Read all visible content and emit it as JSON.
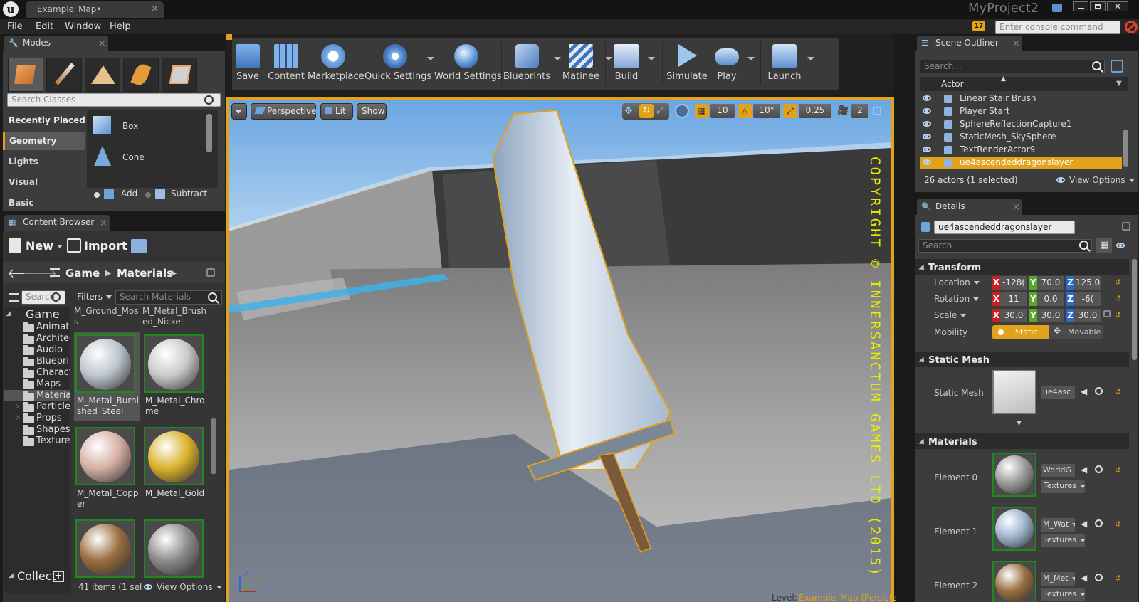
{
  "window": {
    "doc_tab": "Example_Map•",
    "project": "MyProject2"
  },
  "menu": [
    "File",
    "Edit",
    "Window",
    "Help"
  ],
  "console": {
    "placeholder": "Enter console command",
    "badge": "17"
  },
  "modes": {
    "tab": "Modes",
    "search_placeholder": "Search Classes",
    "categories": [
      "Recently Placed",
      "Geometry",
      "Lights",
      "Visual",
      "Basic"
    ],
    "items": [
      "Box",
      "Cone"
    ],
    "add": "Add",
    "subtract": "Subtract"
  },
  "content_browser": {
    "tab": "Content Browser",
    "new": "New",
    "import": "Import",
    "path": [
      "Game",
      "Materials"
    ],
    "search_small": "Search",
    "filters": "Filters",
    "search_materials": "Search Materials",
    "tree": {
      "root": "Game",
      "folders": [
        "Animati",
        "Architec",
        "Audio",
        "Blueprir",
        "Charact",
        "Maps",
        "Materia",
        "Particle",
        "Props",
        "Shapes",
        "Texture"
      ]
    },
    "assets_top": [
      "M_Ground_Moss",
      "M_Metal_Brushed_Nickel"
    ],
    "assets": [
      {
        "name": "M_Metal_Burnished_Steel",
        "color": "#bcc4cc"
      },
      {
        "name": "M_Metal_Chrome",
        "color": "#c8cac9"
      },
      {
        "name": "M_Metal_Copper",
        "color": "#d6b0a6"
      },
      {
        "name": "M_Metal_Gold",
        "color": "#d9b22c"
      },
      {
        "name": "",
        "color": "#9a6e3f"
      },
      {
        "name": "",
        "color": "#8c8c8c"
      }
    ],
    "collections": "Collect",
    "status": "41 items (1 sel",
    "view_options": "View Options"
  },
  "toolbar": [
    {
      "label": "Save",
      "icon": "save-icon",
      "dd": false
    },
    {
      "label": "Content",
      "icon": "content-icon",
      "dd": false
    },
    {
      "label": "Marketplace",
      "icon": "marketplace-icon",
      "dd": false
    },
    {
      "label": "Quick Settings",
      "icon": "quick-settings-icon",
      "dd": true
    },
    {
      "label": "World Settings",
      "icon": "world-settings-icon",
      "dd": false
    },
    {
      "label": "Blueprints",
      "icon": "blueprints-icon",
      "dd": true
    },
    {
      "label": "Matinee",
      "icon": "matinee-icon",
      "dd": true
    },
    {
      "label": "Build",
      "icon": "build-icon",
      "dd": true
    },
    {
      "label": "Simulate",
      "icon": "simulate-icon",
      "dd": false
    },
    {
      "label": "Play",
      "icon": "play-icon",
      "dd": true
    },
    {
      "label": "Launch",
      "icon": "launch-icon",
      "dd": true
    }
  ],
  "viewport": {
    "perspective": "Perspective",
    "lit": "Lit",
    "show": "Show",
    "grid": "10",
    "rotation": "10°",
    "scale": "0.25",
    "camera": "2",
    "watermark": "COPYRIGHT © INNERSANCTUM GAMES LTD (2015)",
    "level_label": "Level:",
    "level_name": "Example_Map (Persistent)",
    "axes": {
      "z": "Z",
      "y": "Y"
    }
  },
  "outliner": {
    "tab": "Scene Outliner",
    "search_placeholder": "Search...",
    "column": "Actor",
    "rows": [
      {
        "name": "Linear Stair Brush",
        "selected": false
      },
      {
        "name": "Player Start",
        "selected": false
      },
      {
        "name": "SphereReflectionCapture1",
        "selected": false
      },
      {
        "name": "StaticMesh_SkySphere",
        "selected": false
      },
      {
        "name": "TextRenderActor9",
        "selected": false
      },
      {
        "name": "ue4ascendeddragonslayer",
        "selected": true
      }
    ],
    "status": "26 actors (1 selected)",
    "view_options": "View Options"
  },
  "details": {
    "tab": "Details",
    "object_name": "ue4ascendeddragonslayer",
    "search_placeholder": "Search",
    "transform_header": "Transform",
    "location_label": "Location",
    "location": {
      "x": "-128(",
      "y": "70.0",
      "z": "125.0"
    },
    "rotation_label": "Rotation",
    "rotation": {
      "x": "11",
      "y": "0.0",
      "z": "-6("
    },
    "scale_label": "Scale",
    "scale": {
      "x": "30.0",
      "y": "30.0",
      "z": "30.0"
    },
    "mobility_label": "Mobility",
    "static": "Static",
    "movable": "Movable",
    "static_mesh_header": "Static Mesh",
    "static_mesh_label": "Static Mesh",
    "static_mesh_value": "ue4asc",
    "materials_header": "Materials",
    "elements": [
      {
        "label": "Element 0",
        "value": "WorldG",
        "textures": "Textures",
        "color": "#9b9b9b"
      },
      {
        "label": "Element 1",
        "value": "M_Wat",
        "textures": "Textures",
        "color": "#9db4cc"
      },
      {
        "label": "Element 2",
        "value": "M_Met",
        "textures": "Textures",
        "color": "#9a6e3f"
      }
    ]
  }
}
